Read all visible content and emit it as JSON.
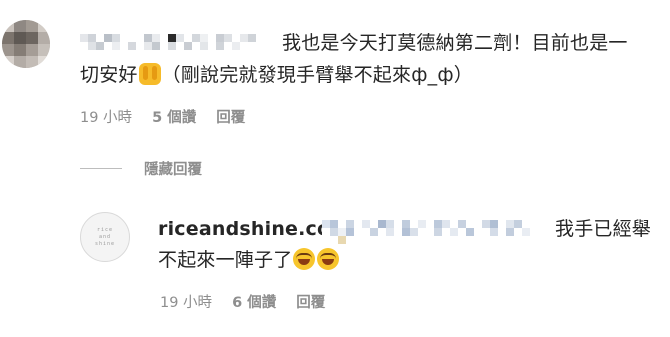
{
  "comment": {
    "text_line1": "我也是今天打莫德納第二劑！目前也是一",
    "text_line2_pre": "切安好",
    "text_line2_post": "（剛說完就發現手臂舉不起來ф_ф）",
    "time": "19 小時",
    "likes": "5 個讚",
    "reply": "回覆"
  },
  "hide_replies": {
    "label": "隱藏回覆"
  },
  "reply_comment": {
    "username": "riceandshine.co",
    "text_line1": "我手已經舉",
    "text_line2": "不起來一陣子了",
    "time": "19 小時",
    "likes": "6 個讚",
    "reply": "回覆",
    "avatar_logo": [
      "rice",
      "and",
      "shine"
    ]
  },
  "icons": {
    "verified": "verified-badge-icon",
    "emoji_hands": "raising-hands-emoji-icon",
    "emoji_laugh": "rolling-on-floor-laughing-emoji-icon"
  },
  "colors": {
    "text": "#262626",
    "meta": "#8e8e8e",
    "verified": "#3897f0"
  }
}
